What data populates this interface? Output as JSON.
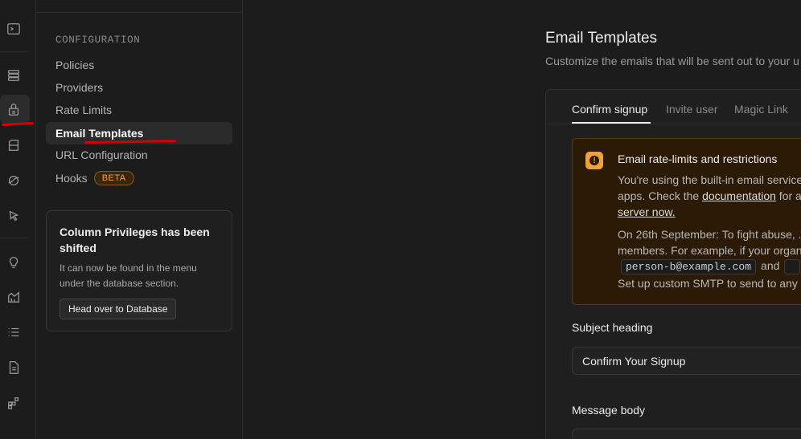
{
  "rail": {
    "icons": [
      "terminal-icon",
      "database-icon",
      "lock-icon",
      "storage-icon",
      "realtime-icon",
      "pointer-icon",
      "lightbulb-icon",
      "reports-icon",
      "list-icon",
      "document-icon",
      "integrations-icon"
    ]
  },
  "sidebar": {
    "section_title": "CONFIGURATION",
    "items": [
      {
        "label": "Policies"
      },
      {
        "label": "Providers"
      },
      {
        "label": "Rate Limits"
      },
      {
        "label": "Email Templates"
      },
      {
        "label": "URL Configuration"
      },
      {
        "label": "Hooks",
        "badge": "BETA"
      }
    ],
    "notice": {
      "title": "Column Privileges has been shifted",
      "text": "It can now be found in the menu under the database section.",
      "button": "Head over to Database"
    }
  },
  "main": {
    "title": "Email Templates",
    "subtitle": "Customize the emails that will be sent out to your u",
    "tabs": [
      {
        "label": "Confirm signup"
      },
      {
        "label": "Invite user"
      },
      {
        "label": "Magic Link"
      }
    ],
    "warning": {
      "title": "Email rate-limits and restrictions",
      "line1": "You're using the built-in email service",
      "line2_pre": "apps. Check the ",
      "line2_link": "documentation",
      "line2_post": " for a",
      "line3_link": "server now.",
      "line4": "On 26th September: To fight abuse, .",
      "line5": "members. For example, if your organ",
      "code1": "person-b@example.com",
      "code_and": "and",
      "line7": "Set up custom SMTP to send to any"
    },
    "subject_label": "Subject heading",
    "subject_value": "Confirm Your Signup",
    "body_label": "Message body"
  },
  "colors": {
    "background": "#1c1c1c",
    "accent_warning": "#f1a13b",
    "annotation": "#d40000"
  }
}
